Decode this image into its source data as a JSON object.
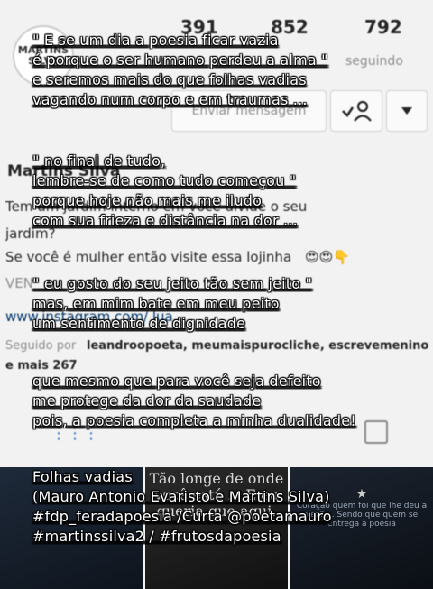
{
  "profile": {
    "logo_text": "MARTINS SILVA",
    "stats": {
      "posts": "391",
      "followers": "852",
      "following": "792"
    },
    "stat_labels": {
      "following": "seguindo"
    },
    "message_button": "Enviar mensagem",
    "name": "Martins Silva",
    "bio_lines": [
      "Tem um jardim interno em você divide o seu",
      "jardim?",
      "Se você é mulher então visite essa lojinha",
      "VEN",
      "www.instagram.com/ lua..."
    ],
    "followed_by_prefix": "Seguido por",
    "followed_by_names": "leandroopoeta, meumaispurocliche, escrevemenino",
    "followed_by_more": "e mais 267"
  },
  "thumbnails": {
    "middle_text": "Tão longe de onde você está ... E eu queria que aqui.",
    "right_text": "Coração quem foi que lhe deu a vez? ... Sendo que quem se entrega à poesia"
  },
  "poem": {
    "stanza1": [
      "\" E se um dia a poesia ficar vazia",
      "é porque o ser humano perdeu a alma \"",
      "e seremos mais do que folhas vadias",
      "vagando num corpo e em traumas ..."
    ],
    "stanza2": [
      "\" no final de tudo,",
      "lembre-se de como tudo começou \"",
      "porque hoje não mais me iludo",
      "com sua frieza e distância na dor ..."
    ],
    "stanza3": [
      "\" eu gosto do seu jeito tão sem jeito \"",
      "mas, em mim bate em meu peito",
      "um sentimento de dignidade"
    ],
    "stanza4": [
      "que mesmo que para você seja defeito",
      "me protege da dor da saudade",
      "pois, a poesia completa a minha dualidade!"
    ],
    "signature": [
      "Folhas vadias",
      "(Mauro Antonio Evaristo e Martins Silva)",
      "#fdp_feradapoesia /Curta @poetamauro",
      "#martinssilva2 / #frutosdapoesia"
    ]
  }
}
